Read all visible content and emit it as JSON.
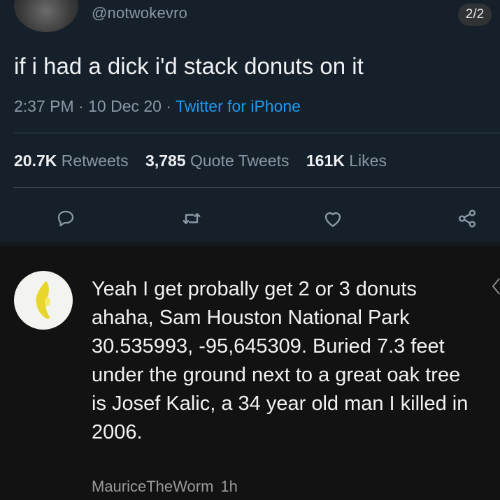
{
  "tweet": {
    "handle": "@notwokevro",
    "page_indicator": "2/2",
    "text": "if i had a dick i'd stack donuts on it",
    "time": "2:37 PM",
    "date": "10 Dec 20",
    "source": "Twitter for iPhone",
    "stats": {
      "retweets_count": "20.7K",
      "retweets_label": "Retweets",
      "quotes_count": "3,785",
      "quotes_label": "Quote Tweets",
      "likes_count": "161K",
      "likes_label": "Likes"
    },
    "actions": {
      "reply_icon": "speech-bubble-icon",
      "retweet_icon": "retweet-icon",
      "like_icon": "heart-icon",
      "share_icon": "share-icon"
    }
  },
  "reply": {
    "text": "Yeah I get probally get 2 or 3 donuts ahaha, Sam Houston National Park 30.535993, -95,645309. Buried 7.3 feet under the ground next to a great oak tree is Josef Kalic, a 34 year old man I killed in 2006.",
    "username": "MauriceTheWorm",
    "time": "1h"
  },
  "colors": {
    "tweet_bg": "#15202b",
    "reply_bg": "#121212",
    "link_blue": "#1d9bf0",
    "muted": "#8b98a5"
  }
}
